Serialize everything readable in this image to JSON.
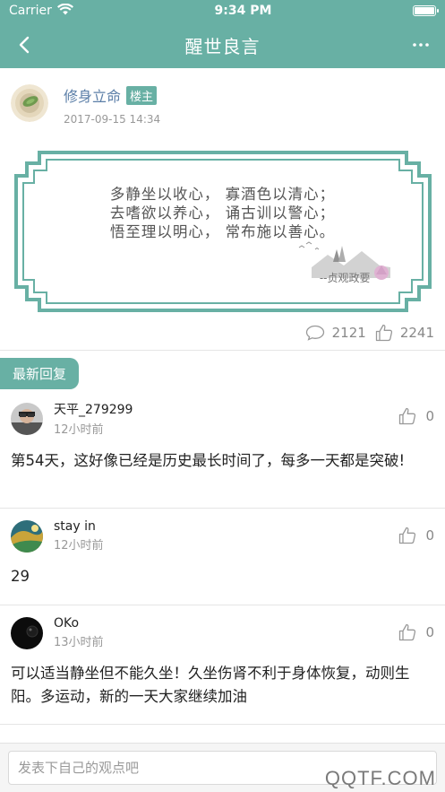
{
  "status_bar": {
    "carrier": "Carrier",
    "time": "9:34 PM",
    "battery_level": 1.0
  },
  "nav": {
    "title": "醒世良言"
  },
  "post": {
    "author": "修身立命",
    "badge": "楼主",
    "time": "2017-09-15 14:34",
    "poem_lines": [
      "多静坐以收心， 寡酒色以清心；",
      "去嗜欲以养心， 诵古训以警心；",
      "悟至理以明心， 常布施以善心。"
    ],
    "signature": "--贞观政要",
    "comments": "2121",
    "likes": "2241"
  },
  "section_title": "最新回复",
  "replies": [
    {
      "name": "天平_279299",
      "time": "12小时前",
      "likes": "0",
      "body": "第54天，这好像已经是历史最长时间了，每多一天都是突破!"
    },
    {
      "name": "stay in",
      "time": "12小时前",
      "likes": "0",
      "body": "29"
    },
    {
      "name": "OKo",
      "time": "13小时前",
      "likes": "0",
      "body": "可以适当静坐但不能久坐！久坐伤肾不利于身体恢复，动则生阳。多运动，新的一天大家继续加油"
    }
  ],
  "comment_box": {
    "placeholder": "发表下自己的观点吧"
  },
  "watermark": "QQTF.COM",
  "colors": {
    "accent": "#68b0a4",
    "author": "#5c7fa8"
  },
  "icons": [
    "wifi-icon",
    "battery-icon",
    "back-chevron-icon",
    "more-dots-icon",
    "comment-bubble-icon",
    "thumbs-up-icon"
  ]
}
